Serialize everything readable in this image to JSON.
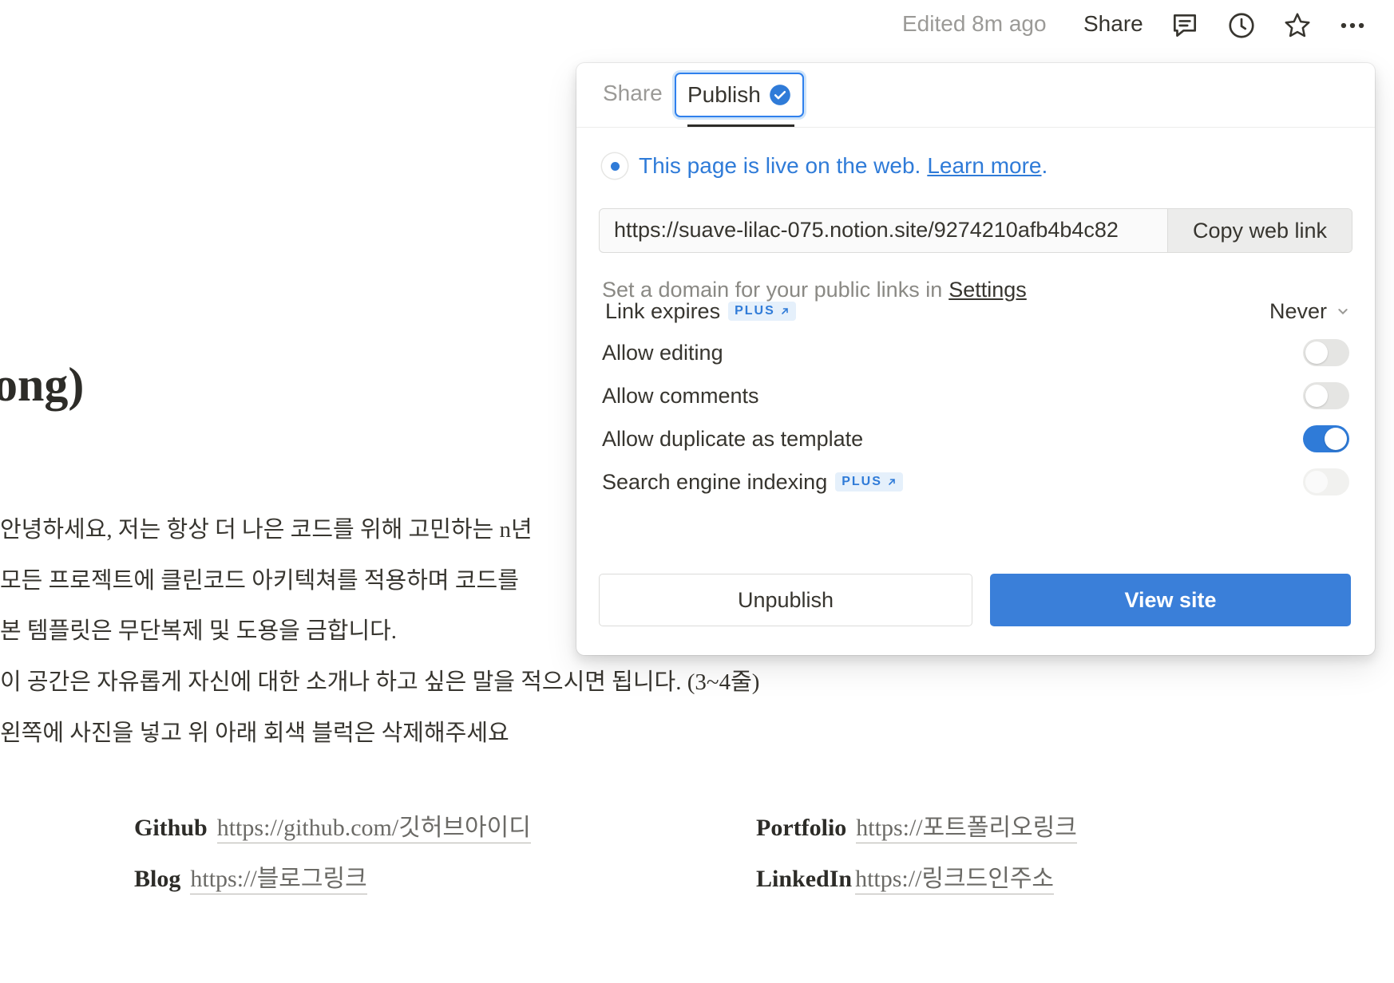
{
  "topbar": {
    "edited": "Edited 8m ago",
    "share_label": "Share"
  },
  "page": {
    "title_fragment": "ong)",
    "paragraphs": [
      "안녕하세요, 저는 항상 더 나은 코드를 위해 고민하는 n년",
      "모든 프로젝트에 클린코드 아키텍쳐를 적용하며 코드를",
      "본 템플릿은 무단복제 및 도용을 금합니다.",
      "이 공간은 자유롭게 자신에 대한 소개나 하고 싶은 말을 적으시면 됩니다. (3~4줄)",
      "왼쪽에 사진을 넣고 위 아래 회색 블럭은 삭제해주세요"
    ],
    "links": [
      {
        "label": "Github",
        "url": "https://github.com/깃허브아이디"
      },
      {
        "label": "Portfolio",
        "url": "https://포트폴리오링크"
      },
      {
        "label": "Blog",
        "url": "https://블로그링크"
      },
      {
        "label": "LinkedIn",
        "url": "https://링크드인주소"
      }
    ]
  },
  "panel": {
    "tabs": {
      "share": "Share",
      "publish": "Publish"
    },
    "live_text": "This page is live on the web.",
    "learn_more": "Learn more",
    "live_period": ".",
    "web_url": "https://suave-lilac-075.notion.site/9274210afb4b4c82",
    "copy_link": "Copy web link",
    "domain_text": "Set a domain for your public links in",
    "settings_link": "Settings",
    "plus_badge": "PLUS",
    "link_expires": {
      "label": "Link expires",
      "value": "Never"
    },
    "options": [
      {
        "label": "Allow editing",
        "enabled": false
      },
      {
        "label": "Allow comments",
        "enabled": false
      },
      {
        "label": "Allow duplicate as template",
        "enabled": true
      },
      {
        "label": "Search engine indexing",
        "enabled": false,
        "disabled": true
      }
    ],
    "unpublish": "Unpublish",
    "view_site": "View site"
  },
  "colors": {
    "accent": "#2f7bd8",
    "text": "#37352f",
    "muted": "#9b9a97"
  }
}
